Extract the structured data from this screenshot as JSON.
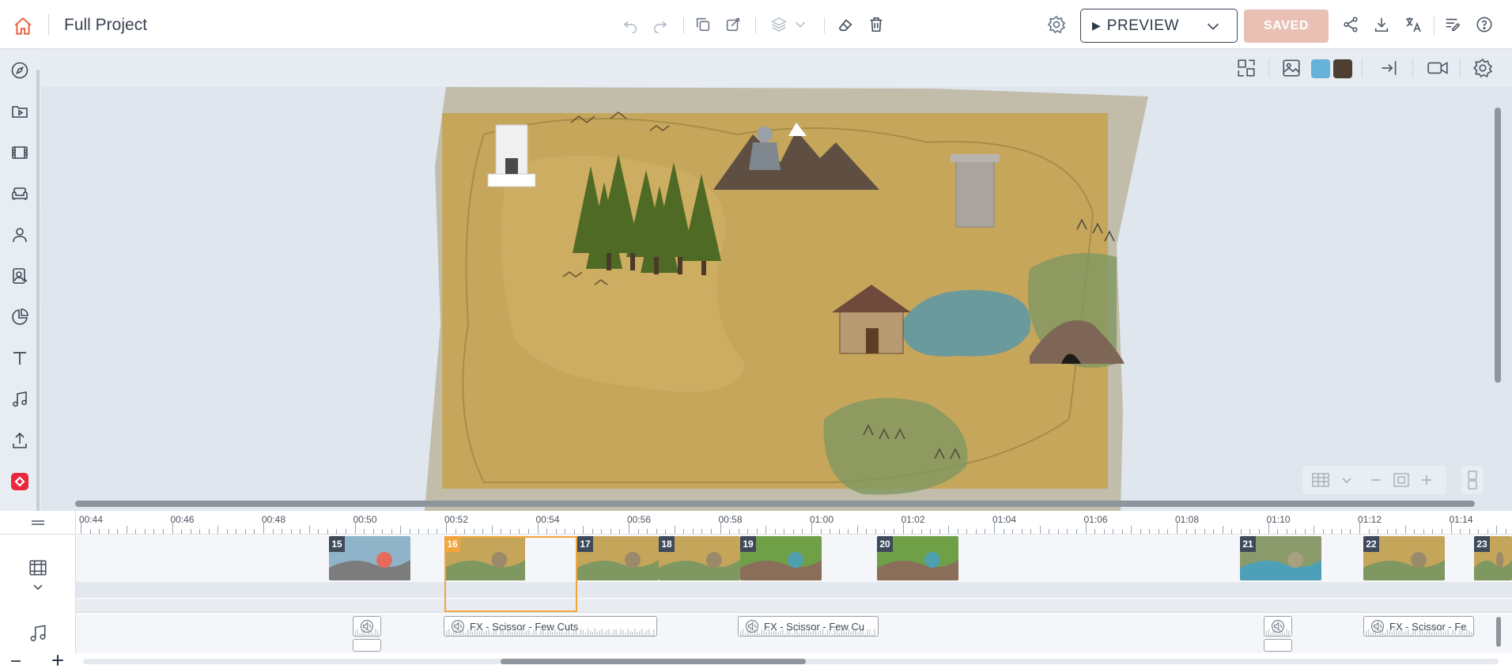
{
  "topbar": {
    "project_title": "Full Project",
    "preview_label": "PREVIEW",
    "saved_label": "SAVED"
  },
  "toolbar": {
    "swatch_primary": "#67b2d8",
    "swatch_secondary": "#4e3f32"
  },
  "timeline": {
    "ruler_labels": [
      "00:44",
      "00:46",
      "00:48",
      "00:50",
      "00:52",
      "00:54",
      "00:56",
      "00:58",
      "01:00",
      "01:02",
      "01:04",
      "01:06",
      "01:08",
      "01:10",
      "01:12",
      "01:14"
    ],
    "clips": [
      {
        "num": "15",
        "scene": "rocks"
      },
      {
        "num": "16",
        "scene": "map",
        "active": true
      },
      {
        "num": "17",
        "scene": "map"
      },
      {
        "num": "18",
        "scene": "map"
      },
      {
        "num": "19",
        "scene": "village"
      },
      {
        "num": "20",
        "scene": "village"
      },
      {
        "num": "21",
        "scene": "lake"
      },
      {
        "num": "22",
        "scene": "map"
      },
      {
        "num": "23",
        "scene": "map"
      }
    ],
    "audio_clips": [
      {
        "name": ""
      },
      {
        "name": "FX - Scissor - Few Cuts"
      },
      {
        "name": "FX - Scissor - Few Cu"
      },
      {
        "name": ""
      },
      {
        "name": "FX - Scissor - Fe"
      }
    ]
  },
  "colors": {
    "accent": "#e8603c",
    "selection": "#f2a53d",
    "saved_bg": "#e8c0b4"
  }
}
